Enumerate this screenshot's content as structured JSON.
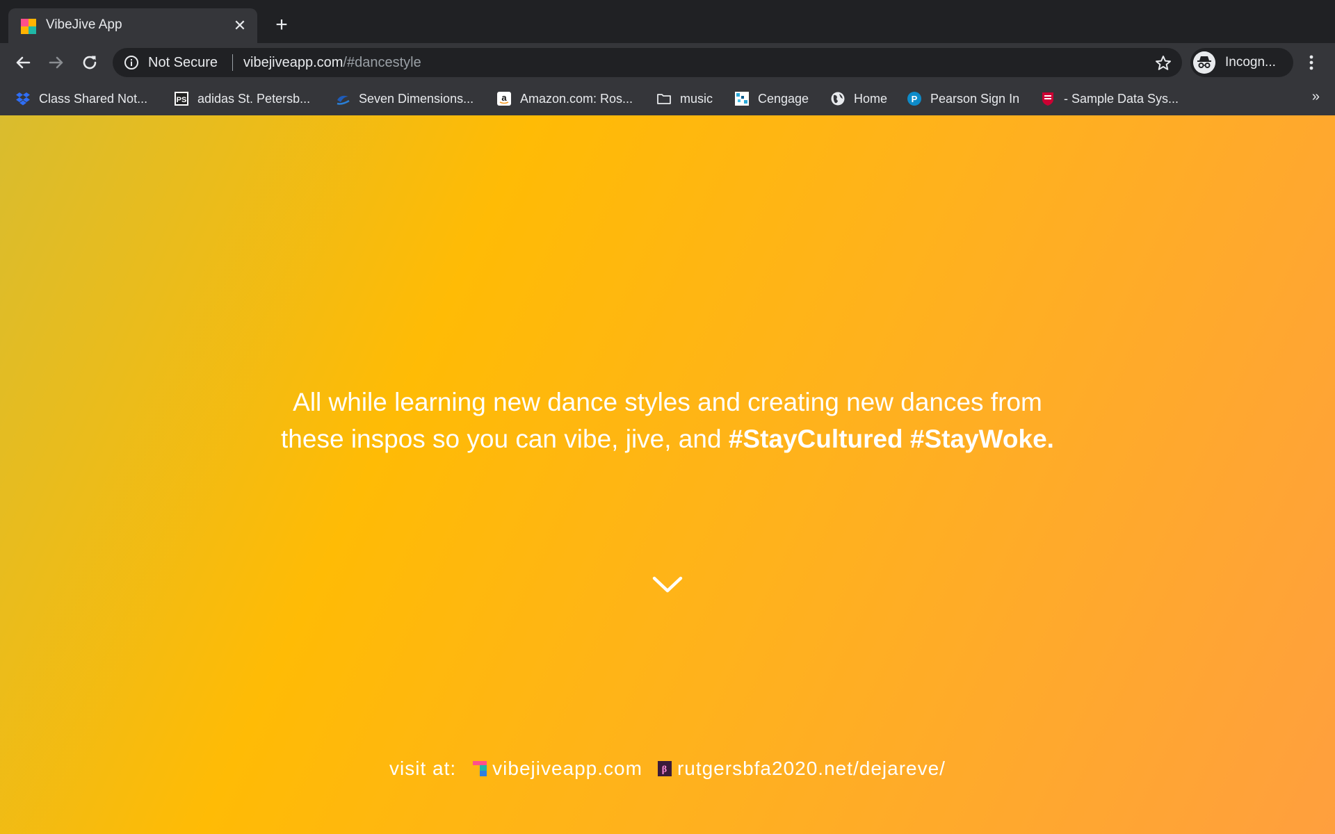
{
  "tab": {
    "title": "VibeJive App",
    "favicon": "vibejive-logo-icon"
  },
  "toolbar": {
    "security_label": "Not Secure",
    "url_host": "vibejiveapp.com",
    "url_path": "/#dancestyle",
    "profile_label": "Incogn..."
  },
  "bookmarks": [
    {
      "label": "Class Shared Not...",
      "icon": "dropbox-icon"
    },
    {
      "label": "adidas St. Petersb...",
      "icon": "ps-icon"
    },
    {
      "label": "Seven Dimensions...",
      "icon": "seven-dimensions-icon"
    },
    {
      "label": "Amazon.com: Ros...",
      "icon": "amazon-icon"
    },
    {
      "label": "music",
      "icon": "folder-icon"
    },
    {
      "label": "Cengage",
      "icon": "cengage-icon"
    },
    {
      "label": "Home",
      "icon": "globe-icon"
    },
    {
      "label": "Pearson Sign In",
      "icon": "pearson-icon"
    },
    {
      "label": "- Sample Data Sys...",
      "icon": "rutgers-icon"
    }
  ],
  "bookmarks_more": "»",
  "page": {
    "headline_line1": "All while learning new dance styles and creating new dances from",
    "headline_line2_plain": "these inspos so you can vibe, jive, and ",
    "headline_hashtags": "#StayCultured #StayWoke.",
    "footer_visit": "visit at:",
    "footer_link1": "vibejiveapp.com",
    "footer_link2": "rutgersbfa2020.net/dejareve/"
  },
  "colors": {
    "chrome_dark": "#202124",
    "chrome_toolbar": "#35363a",
    "page_gradient_start": "#d9bc2e",
    "page_gradient_mid": "#ffbb05",
    "page_gradient_end": "#ff9f3e",
    "text": "#ffffff"
  }
}
